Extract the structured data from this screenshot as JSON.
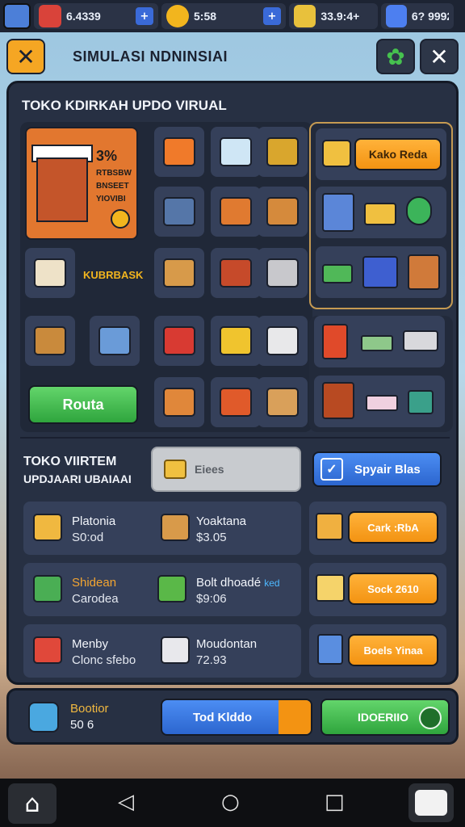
{
  "resources": [
    {
      "icon": "red-gem-icon",
      "value": "6.4339",
      "color": "#d9433a"
    },
    {
      "icon": "gold-coin-icon",
      "value": "5:58",
      "color": "#f2b51e"
    },
    {
      "icon": "gold-bars-icon",
      "value": "33.9:4+",
      "color": "#e8c13c"
    },
    {
      "icon": "blue-gem-icon",
      "value": "6? 9992",
      "color": "#4d7ff0"
    }
  ],
  "header": {
    "title": "SIMULASI NDNINSIAI",
    "close_icon": "x-icon",
    "settings_icon": "green-gear-icon"
  },
  "shop": {
    "title": "TOKO KDIRKAH UPDO VIRUAL",
    "featured": {
      "discount": "3%",
      "label_lines": [
        "RTBSBW",
        "BNSEET",
        "YIOVIBI"
      ]
    },
    "kurbrask_label": "KUBRBASK",
    "right_buy_label": "Kako Reda",
    "route_button": "Routa",
    "tile_icons": [
      "orange-van-icon",
      "mailbox-icon",
      "forklift-icon",
      "blue-truck-icon",
      "cash-register-icon",
      "crate-icon",
      "delivery-van-icon",
      "coin-box-icon",
      "plant-pot-icon",
      "silver-car-icon",
      "vegetable-crate-icon",
      "blue-car-icon",
      "red-van-icon",
      "yellow-machine-icon",
      "newspaper-icon",
      "plant-box-icon",
      "printer-icon",
      "cardboard-box-icon"
    ]
  },
  "items_section": {
    "title_line1": "TOKO VIIRTEM",
    "title_line2": "UPDJAARI UBAIAAI",
    "gray_button": "Eiees",
    "blue_button": "Spyair Blas",
    "items": [
      {
        "name": "Platonia",
        "price": "S0:od",
        "icon": "treasure-box-icon"
      },
      {
        "name": "Yoaktana",
        "price": "$3.05",
        "icon": "wooden-box-icon"
      },
      {
        "name": "Shidean",
        "price": "Carodea",
        "icon": "green-chest-icon"
      },
      {
        "name": "Bolt dhoadé",
        "name_highlight": "ked",
        "price": "$9:06",
        "icon": "plant-cart-icon"
      },
      {
        "name": "Menby",
        "price": "Clonc sfebo",
        "icon": "red-shelf-icon"
      },
      {
        "name": "Moudontan",
        "price": "72.93",
        "icon": "paper-stack-icon"
      }
    ],
    "side_buttons": [
      "Cark :RbA",
      "Sock 2610",
      "Boels Yinaa"
    ]
  },
  "footer": {
    "label": "Bootior",
    "value": "50 6",
    "blue_button": "Tod Klddo",
    "green_button": "IDOERIIO"
  },
  "colors": {
    "accent_orange": "#f39312",
    "accent_green": "#2fa53d",
    "accent_blue": "#2c66cf",
    "panel": "#273043"
  }
}
